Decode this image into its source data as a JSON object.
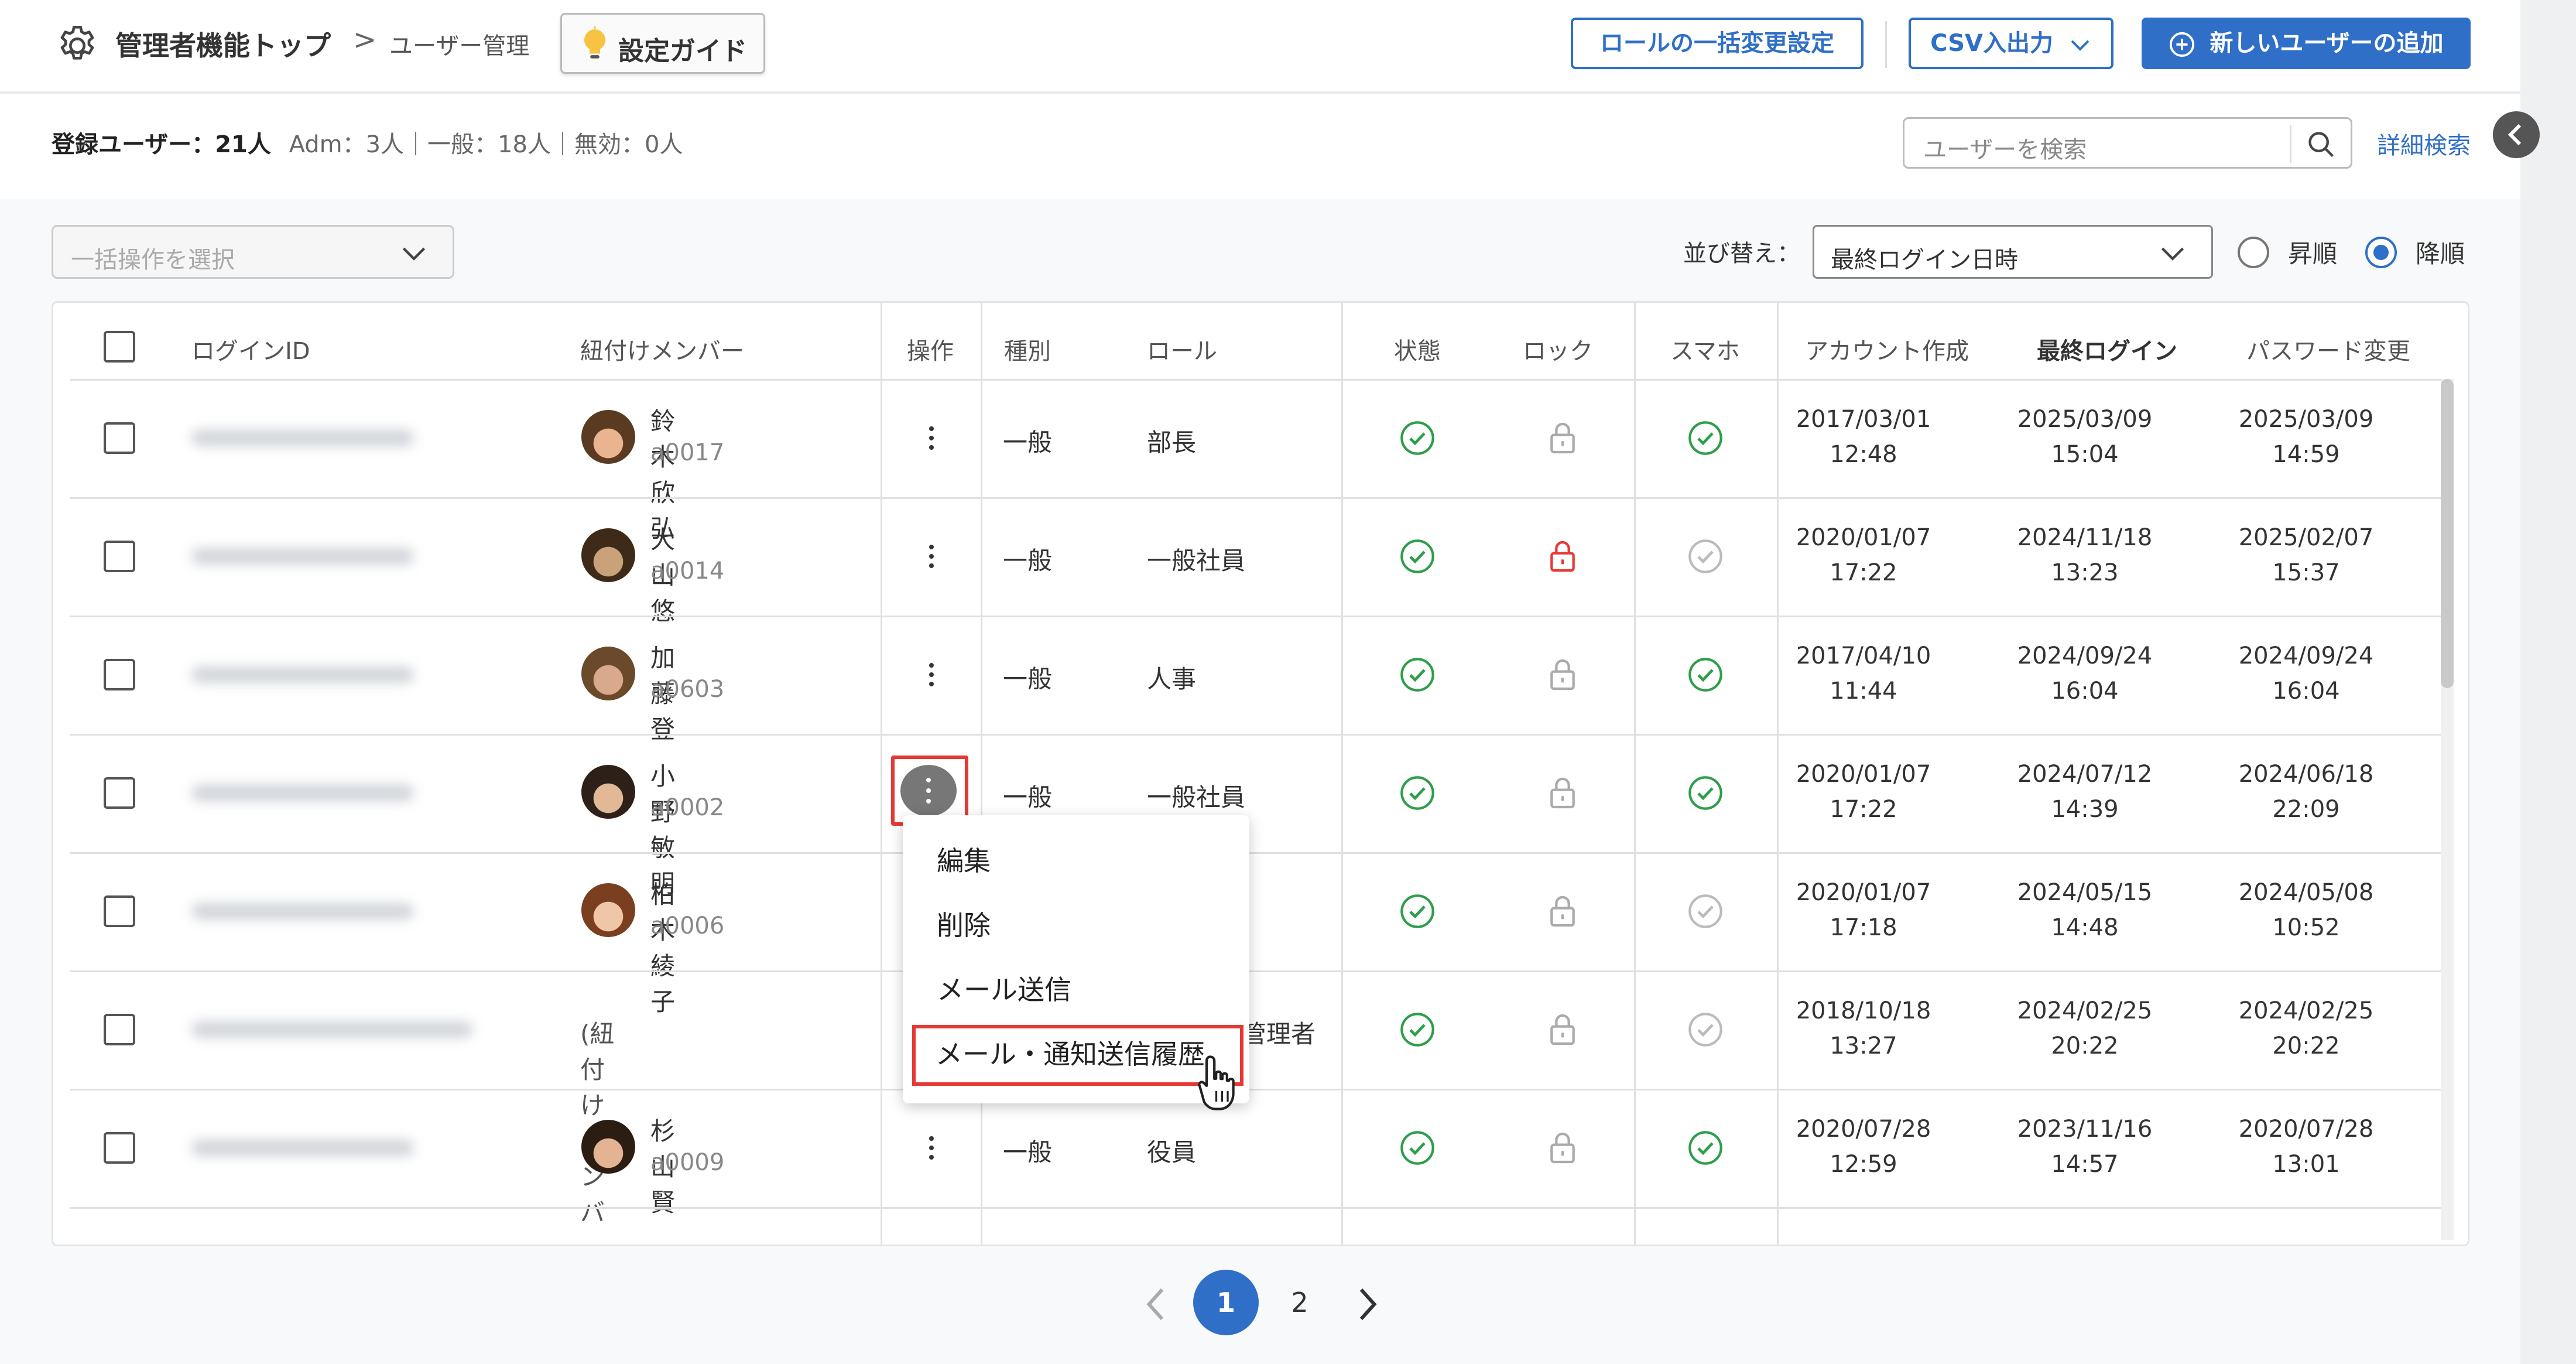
{
  "header": {
    "breadcrumb_main": "管理者機能トップ",
    "breadcrumb_sep": ">",
    "breadcrumb_current": "ユーザー管理",
    "guide_button": "設定ガイド",
    "role_bulk_button": "ロールの一括変更設定",
    "csv_button": "CSV入出力",
    "add_user_button": "新しいユーザーの追加"
  },
  "summary": {
    "total": "登録ユーザー：21人",
    "detail": "Adm：3人｜一般：18人｜無効：0人"
  },
  "search": {
    "placeholder": "ユーザーを検索",
    "advanced": "詳細検索"
  },
  "toolbar": {
    "bulk_placeholder": "一括操作を選択",
    "sort_label": "並び替え：",
    "sort_value": "最終ログイン日時",
    "asc": "昇順",
    "desc": "降順",
    "sort_direction": "desc"
  },
  "table": {
    "columns": [
      "ログインID",
      "紐付けメンバー",
      "操作",
      "種別",
      "ロール",
      "状態",
      "ロック",
      "スマホ",
      "アカウント作成",
      "最終ログイン",
      "パスワード変更"
    ],
    "rows": [
      {
        "member": "鈴木 欣弘",
        "member_id": "a0017",
        "type": "一般",
        "role": "部長",
        "status": "ok",
        "lock": "unlocked",
        "phone": "ok",
        "created": [
          "2017/03/01",
          "12:48"
        ],
        "last_login": [
          "2025/03/09",
          "15:04"
        ],
        "pw_changed": [
          "2025/03/09",
          "14:59"
        ]
      },
      {
        "member": "大山 悠",
        "member_id": "a0014",
        "type": "一般",
        "role": "一般社員",
        "status": "ok",
        "lock": "locked",
        "phone": "inactive",
        "created": [
          "2020/01/07",
          "17:22"
        ],
        "last_login": [
          "2024/11/18",
          "13:23"
        ],
        "pw_changed": [
          "2025/02/07",
          "15:37"
        ]
      },
      {
        "member": "加藤 登",
        "member_id": "a0603",
        "type": "一般",
        "role": "人事",
        "status": "ok",
        "lock": "unlocked",
        "phone": "ok",
        "created": [
          "2017/04/10",
          "11:44"
        ],
        "last_login": [
          "2024/09/24",
          "16:04"
        ],
        "pw_changed": [
          "2024/09/24",
          "16:04"
        ]
      },
      {
        "member": "小野 敏明",
        "member_id": "a0002",
        "type": "一般",
        "role": "一般社員",
        "status": "ok",
        "lock": "unlocked",
        "phone": "ok",
        "created": [
          "2020/01/07",
          "17:22"
        ],
        "last_login": [
          "2024/07/12",
          "14:39"
        ],
        "pw_changed": [
          "2024/06/18",
          "22:09"
        ]
      },
      {
        "member": "柏木 綾子",
        "member_id": "a0006",
        "type": "",
        "role": "",
        "status": "ok",
        "lock": "unlocked",
        "phone": "inactive",
        "created": [
          "2020/01/07",
          "17:18"
        ],
        "last_login": [
          "2024/05/15",
          "14:48"
        ],
        "pw_changed": [
          "2024/05/08",
          "10:52"
        ]
      },
      {
        "member": "(紐付けメンバーなし)",
        "member_id": "",
        "type": "",
        "role": "管理者",
        "status": "ok",
        "lock": "unlocked",
        "phone": "inactive",
        "created": [
          "2018/10/18",
          "13:27"
        ],
        "last_login": [
          "2024/02/25",
          "20:22"
        ],
        "pw_changed": [
          "2024/02/25",
          "20:22"
        ]
      },
      {
        "member": "杉山 賢",
        "member_id": "a0009",
        "type": "一般",
        "role": "役員",
        "status": "ok",
        "lock": "unlocked",
        "phone": "ok",
        "created": [
          "2020/07/28",
          "12:59"
        ],
        "last_login": [
          "2023/11/16",
          "14:57"
        ],
        "pw_changed": [
          "2020/07/28",
          "13:01"
        ]
      }
    ]
  },
  "action_menu": {
    "items": [
      "編集",
      "削除",
      "メール送信",
      "メール・通知送信履歴"
    ],
    "highlighted": "メール・通知送信履歴"
  },
  "pagination": {
    "pages": [
      "1",
      "2"
    ],
    "current": "1"
  },
  "colors": {
    "accent": "#2f6fc7",
    "ok": "#2e9e4a",
    "lock_alert": "#e53935",
    "highlight": "#e53935"
  }
}
